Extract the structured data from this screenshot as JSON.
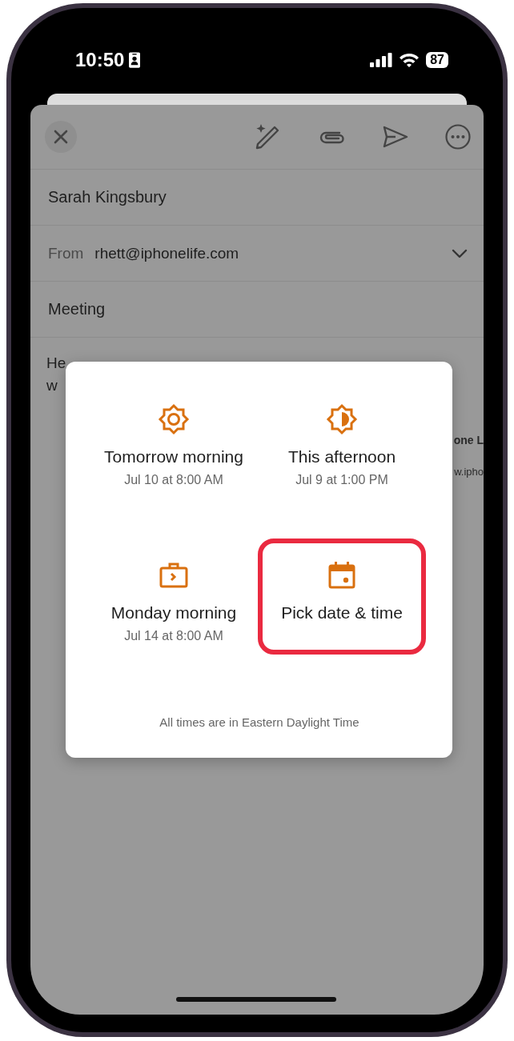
{
  "status_bar": {
    "time": "10:50",
    "battery": "87"
  },
  "compose": {
    "to": "Sarah Kingsbury",
    "from_label": "From",
    "from": "rhett@iphonelife.com",
    "subject": "Meeting",
    "body_lines": [
      "He",
      "w"
    ],
    "signature": [
      "one L",
      "w.ipho"
    ]
  },
  "snooze_dialog": {
    "options": [
      {
        "kind": "sun",
        "label": "Tomorrow morning",
        "time": "Jul 10 at 8:00 AM",
        "highlighted": false
      },
      {
        "kind": "half-sun",
        "label": "This afternoon",
        "time": "Jul 9 at 1:00 PM",
        "highlighted": false
      },
      {
        "kind": "briefcase",
        "label": "Monday morning",
        "time": "Jul 14 at 8:00 AM",
        "highlighted": false
      },
      {
        "kind": "calendar",
        "label": "Pick date & time",
        "highlighted": true
      }
    ],
    "footnote": "All times are in Eastern Daylight Time"
  }
}
